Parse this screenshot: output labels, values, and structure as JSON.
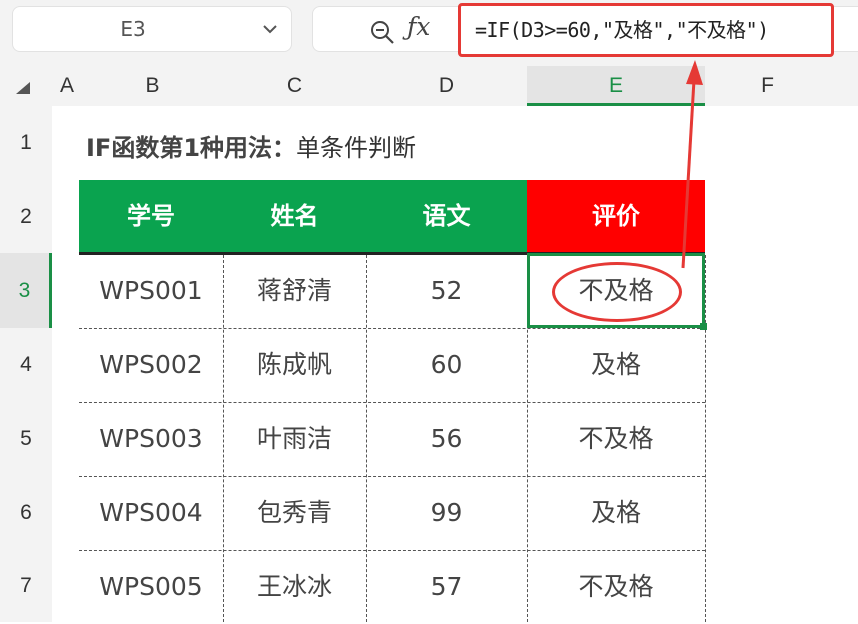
{
  "name_box": {
    "value": "E3"
  },
  "formula_bar": {
    "formula": "=IF(D3>=60,\"及格\",\"不及格\")"
  },
  "columns": [
    "A",
    "B",
    "C",
    "D",
    "E",
    "F"
  ],
  "active_column": "E",
  "rows": [
    "1",
    "2",
    "3",
    "4",
    "5",
    "6",
    "7"
  ],
  "active_row": "3",
  "sheet_title": {
    "bold": "IF函数第1种用法：",
    "rest": "单条件判断"
  },
  "table": {
    "headers": [
      "学号",
      "姓名",
      "语文",
      "评价"
    ],
    "rows": [
      [
        "WPS001",
        "蒋舒清",
        "52",
        "不及格"
      ],
      [
        "WPS002",
        "陈成帆",
        "60",
        "及格"
      ],
      [
        "WPS003",
        "叶雨洁",
        "56",
        "不及格"
      ],
      [
        "WPS004",
        "包秀青",
        "99",
        "及格"
      ],
      [
        "WPS005",
        "王冰冰",
        "57",
        "不及格"
      ]
    ]
  },
  "colors": {
    "header_green": "#0aa34f",
    "header_red": "#ff0000",
    "annotation_red": "#e53935",
    "selection_green": "#1a8f46"
  },
  "icons": [
    "chevron-down-icon",
    "zoom-icon",
    "fx-icon",
    "select-all-icon"
  ]
}
